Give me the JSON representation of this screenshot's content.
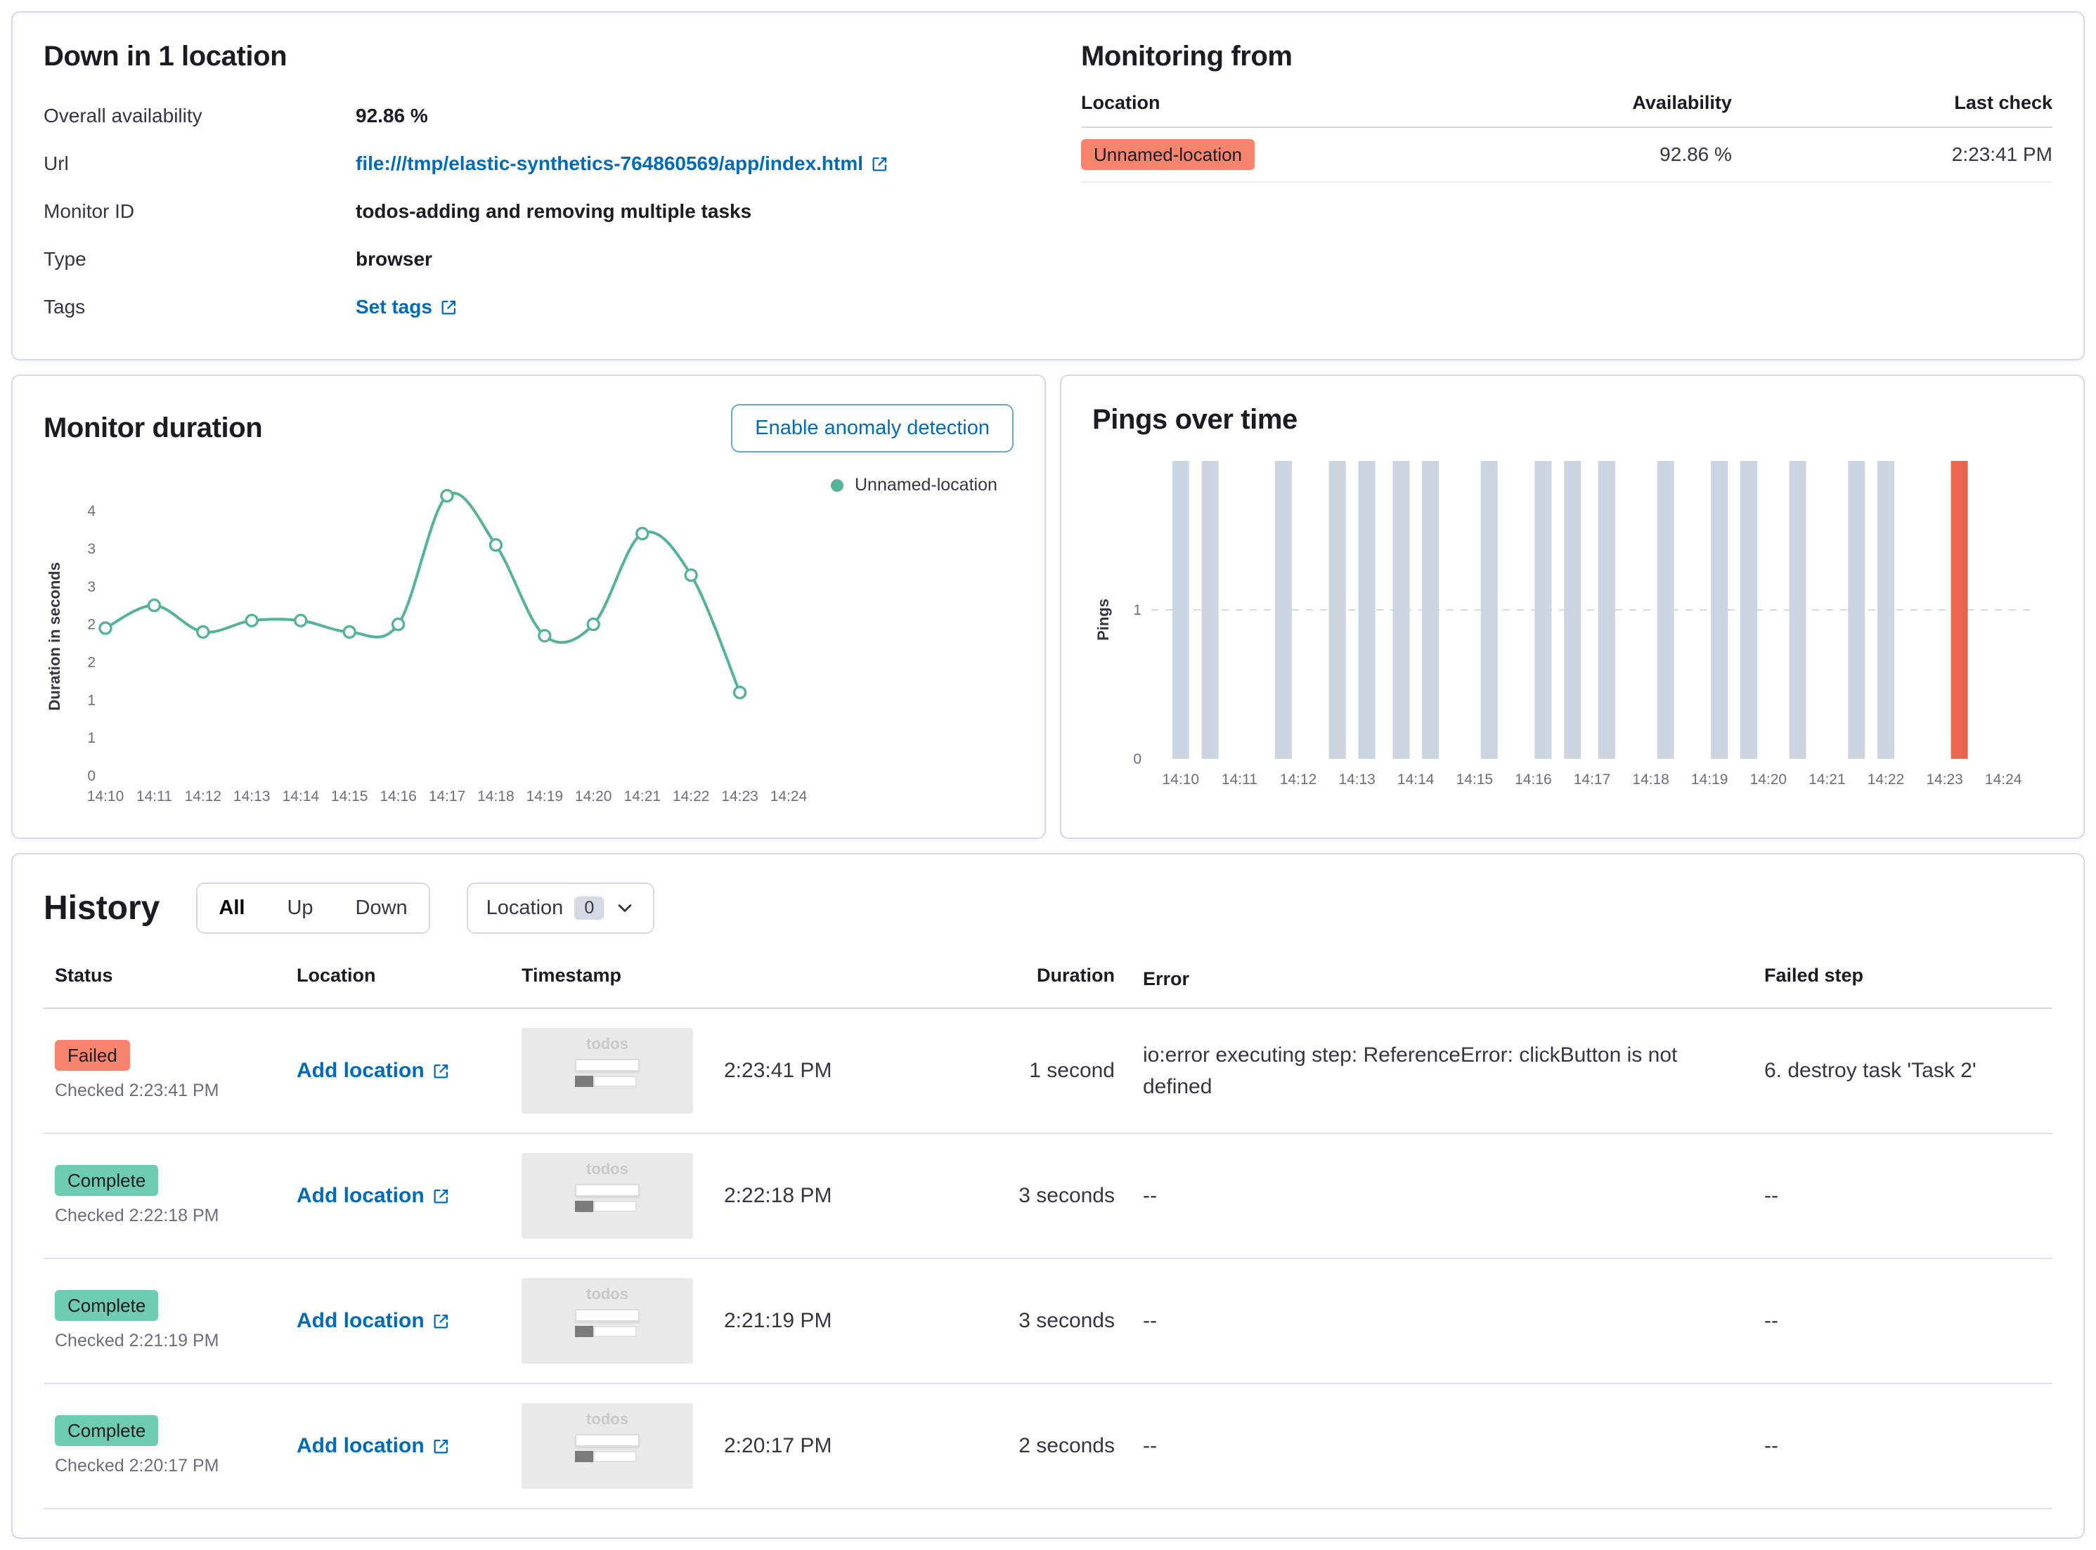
{
  "status_panel": {
    "title": "Down in 1 location",
    "fields": [
      {
        "label": "Overall availability",
        "value": "92.86 %"
      },
      {
        "label": "Url",
        "value": "file:///tmp/elastic-synthetics-764860569/app/index.html"
      },
      {
        "label": "Monitor ID",
        "value": "todos-adding and removing multiple tasks"
      },
      {
        "label": "Type",
        "value": "browser"
      },
      {
        "label": "Tags",
        "value": "Set tags"
      }
    ]
  },
  "monitoring_from": {
    "title": "Monitoring from",
    "columns": [
      "Location",
      "Availability",
      "Last check"
    ],
    "rows": [
      {
        "location": "Unnamed-location",
        "availability": "92.86 %",
        "last_check": "2:23:41 PM"
      }
    ]
  },
  "duration_panel": {
    "title": "Monitor duration",
    "button": "Enable anomaly detection",
    "legend": "Unnamed-location"
  },
  "pings_panel": {
    "title": "Pings over time"
  },
  "history": {
    "title": "History",
    "status_filter": [
      "All",
      "Up",
      "Down"
    ],
    "status_filter_selected": "All",
    "location_filter": {
      "label": "Location",
      "count": "0"
    },
    "columns": [
      "Status",
      "Location",
      "Timestamp",
      "Duration",
      "Error",
      "Failed step"
    ],
    "rows": [
      {
        "status": "Failed",
        "checked": "Checked 2:23:41 PM",
        "location": "Add location",
        "time": "2:23:41 PM",
        "duration": "1 second",
        "error": "io:error executing step: ReferenceError: clickButton is not defined",
        "failed_step": "6. destroy task 'Task 2'",
        "thumb_label": "todos"
      },
      {
        "status": "Complete",
        "checked": "Checked 2:22:18 PM",
        "location": "Add location",
        "time": "2:22:18 PM",
        "duration": "3 seconds",
        "error": "--",
        "failed_step": "--",
        "thumb_label": "todos"
      },
      {
        "status": "Complete",
        "checked": "Checked 2:21:19 PM",
        "location": "Add location",
        "time": "2:21:19 PM",
        "duration": "3 seconds",
        "error": "--",
        "failed_step": "--",
        "thumb_label": "todos"
      },
      {
        "status": "Complete",
        "checked": "Checked 2:20:17 PM",
        "location": "Add location",
        "time": "2:20:17 PM",
        "duration": "2 seconds",
        "error": "--",
        "failed_step": "--",
        "thumb_label": "todos"
      }
    ]
  },
  "colors": {
    "link": "#006BB8",
    "danger_badge": "#F9846D",
    "success_badge": "#6DCCB1",
    "line": "#54B399",
    "bar_up": "#CDD5E2",
    "bar_down": "#E7664C",
    "panel_border": "#D3DAE6"
  },
  "chart_data": [
    {
      "type": "line",
      "title": "Monitor duration",
      "ylabel": "Duration in seconds",
      "xlabel": "",
      "x": [
        "14:10",
        "14:11",
        "14:12",
        "14:13",
        "14:14",
        "14:15",
        "14:16",
        "14:17",
        "14:18",
        "14:19",
        "14:20",
        "14:21",
        "14:22",
        "14:23"
      ],
      "series": [
        {
          "name": "Unnamed-location",
          "values": [
            1.95,
            2.25,
            1.9,
            2.05,
            2.05,
            1.9,
            2.0,
            3.7,
            3.05,
            1.85,
            2.0,
            3.2,
            2.65,
            1.1
          ]
        }
      ],
      "x_ticks": [
        "14:10",
        "14:11",
        "14:12",
        "14:13",
        "14:14",
        "14:15",
        "14:16",
        "14:17",
        "14:18",
        "14:19",
        "14:20",
        "14:21",
        "14:22",
        "14:23",
        "14:24"
      ],
      "y_tick_values": [
        0,
        0.5,
        1,
        1.5,
        2,
        2.5,
        3,
        3.5
      ],
      "y_tick_labels": [
        "0",
        "1",
        "1",
        "2",
        "2",
        "3",
        "3",
        "4"
      ],
      "ylim": [
        0,
        3.9
      ],
      "grid": false,
      "legend_position": "right",
      "color": "#54B399"
    },
    {
      "type": "bar",
      "title": "Pings over time",
      "ylabel": "Pings",
      "xlabel": "",
      "domain": [
        "14:09:30",
        "14:24:30"
      ],
      "x_ticks": [
        "14:10",
        "14:11",
        "14:12",
        "14:13",
        "14:14",
        "14:15",
        "14:16",
        "14:17",
        "14:18",
        "14:19",
        "14:20",
        "14:21",
        "14:22",
        "14:23",
        "14:24"
      ],
      "y_tick_values": [
        0,
        1
      ],
      "ylim": [
        0,
        2
      ],
      "grid": "dashed-horizontal-at-1",
      "bars": [
        {
          "t": "14:10:00",
          "value": 2,
          "status": "up"
        },
        {
          "t": "14:10:30",
          "value": 2,
          "status": "up"
        },
        {
          "t": "14:11:45",
          "value": 2,
          "status": "up"
        },
        {
          "t": "14:12:40",
          "value": 2,
          "status": "up"
        },
        {
          "t": "14:13:10",
          "value": 2,
          "status": "up"
        },
        {
          "t": "14:13:45",
          "value": 2,
          "status": "up"
        },
        {
          "t": "14:14:15",
          "value": 2,
          "status": "up"
        },
        {
          "t": "14:15:15",
          "value": 2,
          "status": "up"
        },
        {
          "t": "14:16:10",
          "value": 2,
          "status": "up"
        },
        {
          "t": "14:16:40",
          "value": 2,
          "status": "up"
        },
        {
          "t": "14:17:15",
          "value": 2,
          "status": "up"
        },
        {
          "t": "14:18:15",
          "value": 2,
          "status": "up"
        },
        {
          "t": "14:19:10",
          "value": 2,
          "status": "up"
        },
        {
          "t": "14:19:40",
          "value": 2,
          "status": "up"
        },
        {
          "t": "14:20:30",
          "value": 2,
          "status": "up"
        },
        {
          "t": "14:21:30",
          "value": 2,
          "status": "up"
        },
        {
          "t": "14:22:00",
          "value": 2,
          "status": "up"
        },
        {
          "t": "14:23:15",
          "value": 2,
          "status": "down"
        }
      ],
      "up_color": "#CDD5E2",
      "down_color": "#E7664C"
    }
  ]
}
